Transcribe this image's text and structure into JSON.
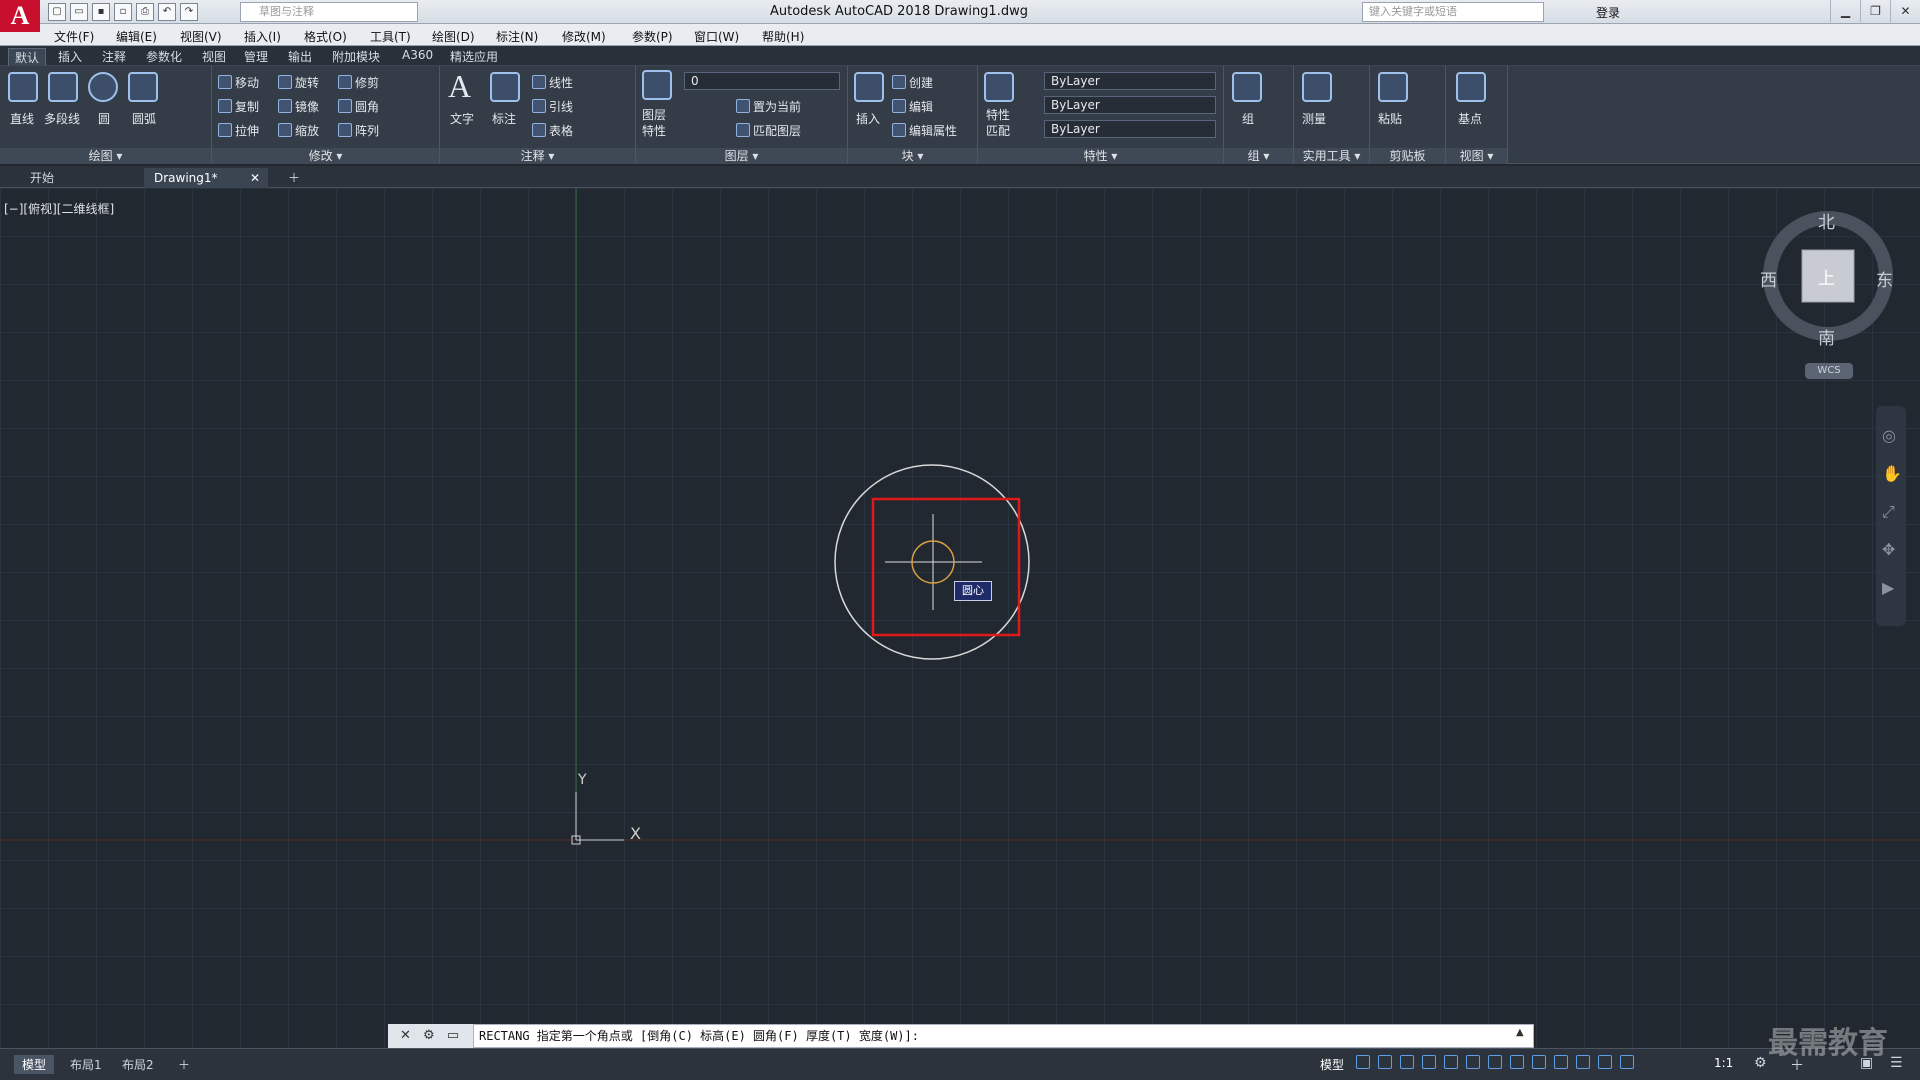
{
  "window": {
    "title": "Autodesk AutoCAD 2018    Drawing1.dwg",
    "workspace": "草图与注释",
    "search_placeholder": "键入关键字或短语",
    "login": "登录",
    "logo": "A"
  },
  "menus": [
    "文件(F)",
    "编辑(E)",
    "视图(V)",
    "插入(I)",
    "格式(O)",
    "工具(T)",
    "绘图(D)",
    "标注(N)",
    "修改(M)",
    "参数(P)",
    "窗口(W)",
    "帮助(H)"
  ],
  "ribbon_tabs": [
    "默认",
    "插入",
    "注释",
    "参数化",
    "视图",
    "管理",
    "输出",
    "附加模块",
    "A360",
    "精选应用"
  ],
  "draw": {
    "line": "直线",
    "polyline": "多段线",
    "circle": "圆",
    "arc": "圆弧",
    "label": "绘图 ▾"
  },
  "modify": {
    "move": "移动",
    "rotate": "旋转",
    "trim": "修剪",
    "copy": "复制",
    "mirror": "镜像",
    "fillet": "圆角",
    "stretch": "拉伸",
    "scale": "缩放",
    "array": "阵列",
    "label": "修改 ▾"
  },
  "annotation": {
    "text": "文字",
    "dim": "标注",
    "linear": "线性",
    "leader": "引线",
    "table": "表格",
    "label": "注释 ▾"
  },
  "layers": {
    "props_line1": "图层",
    "props_line2": "特性",
    "current_layer": "0",
    "set_current": "置为当前",
    "match": "匹配图层",
    "label": "图层 ▾"
  },
  "block": {
    "insert": "插入",
    "create": "创建",
    "edit": "编辑",
    "edit_attr": "编辑属性",
    "label": "块 ▾"
  },
  "properties": {
    "match_line1": "特性",
    "match_line2": "匹配",
    "color": "ByLayer",
    "linetype": "ByLayer",
    "lineweight": "ByLayer",
    "label": "特性 ▾"
  },
  "groups": {
    "group": "组",
    "label": "组 ▾"
  },
  "utilities": {
    "measure": "测量",
    "label": "实用工具 ▾"
  },
  "clipboard": {
    "paste": "粘贴",
    "label": "剪贴板"
  },
  "view": {
    "base": "基点",
    "label": "视图 ▾"
  },
  "doc_tabs": [
    "开始",
    "Drawing1*"
  ],
  "viewport_label": "[−][俯视][二维线框]",
  "navcube": {
    "north": "北",
    "south": "南",
    "west": "西",
    "east": "东",
    "top": "上",
    "wcs": "WCS"
  },
  "ucs": {
    "x": "X",
    "y": "Y"
  },
  "osnap_tooltip": "圆心",
  "command": {
    "text": "RECTANG 指定第一个角点或 [倒角(C) 标高(E) 圆角(F) 厚度(T) 宽度(W)]:"
  },
  "layout_tabs": [
    "模型",
    "布局1",
    "布局2"
  ],
  "status": {
    "model": "模型",
    "scale": "1:1"
  },
  "watermark": "最需教育",
  "colors": {
    "canvas": "#212830",
    "selection_box": "#e01a1a",
    "circle": "#d8d8d8",
    "osnap_marker": "#d8a040"
  }
}
